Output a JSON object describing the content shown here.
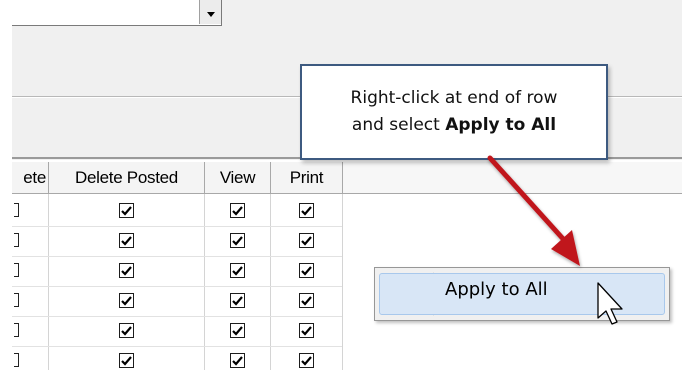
{
  "grid": {
    "columns": [
      {
        "key": "delete",
        "label": "ete"
      },
      {
        "key": "delete_posted",
        "label": "Delete Posted"
      },
      {
        "key": "view",
        "label": "View"
      },
      {
        "key": "print",
        "label": "Print"
      }
    ],
    "rows": [
      {
        "delete_posted": true,
        "view": true,
        "print": true
      },
      {
        "delete_posted": true,
        "view": true,
        "print": true
      },
      {
        "delete_posted": true,
        "view": true,
        "print": true
      },
      {
        "delete_posted": true,
        "view": true,
        "print": true
      },
      {
        "delete_posted": true,
        "view": true,
        "print": true
      },
      {
        "delete_posted": true,
        "view": true,
        "print": true
      }
    ]
  },
  "context_menu": {
    "items": [
      {
        "label": "Apply to All"
      }
    ]
  },
  "callout": {
    "line1": "Right-click at end of row",
    "line2_prefix": "and select ",
    "line2_bold": "Apply to All"
  },
  "colors": {
    "arrow": "#c0161d",
    "callout_border": "#3d5a80",
    "menu_highlight": "#d8e6f6"
  }
}
